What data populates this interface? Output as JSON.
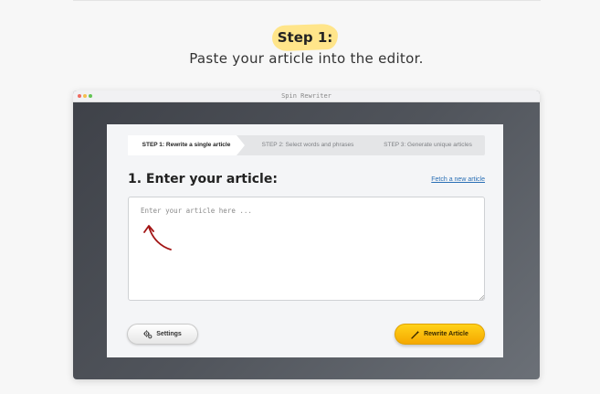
{
  "header": {
    "step_badge": "Step 1:",
    "subtitle": "Paste your article into the editor."
  },
  "window": {
    "title": "Spin Rewriter"
  },
  "steps": [
    {
      "label": "STEP 1: Rewrite a single article",
      "active": true
    },
    {
      "label": "STEP 2: Select words and phrases",
      "active": false
    },
    {
      "label": "STEP 3: Generate unique articles",
      "active": false
    }
  ],
  "editor": {
    "heading": "1. Enter your article:",
    "fetch_link": "Fetch a new article",
    "placeholder": "Enter your article here ...",
    "value": ""
  },
  "actions": {
    "settings_label": "Settings",
    "rewrite_label": "Rewrite Article"
  },
  "colors": {
    "badge_highlight": "#ffe58a",
    "link": "#2a6fb5",
    "primary_button": "#f5b400",
    "arrow": "#a31515"
  },
  "icons": {
    "settings": "gears-icon",
    "rewrite": "magic-wand-icon",
    "hint": "curved-arrow-icon"
  }
}
